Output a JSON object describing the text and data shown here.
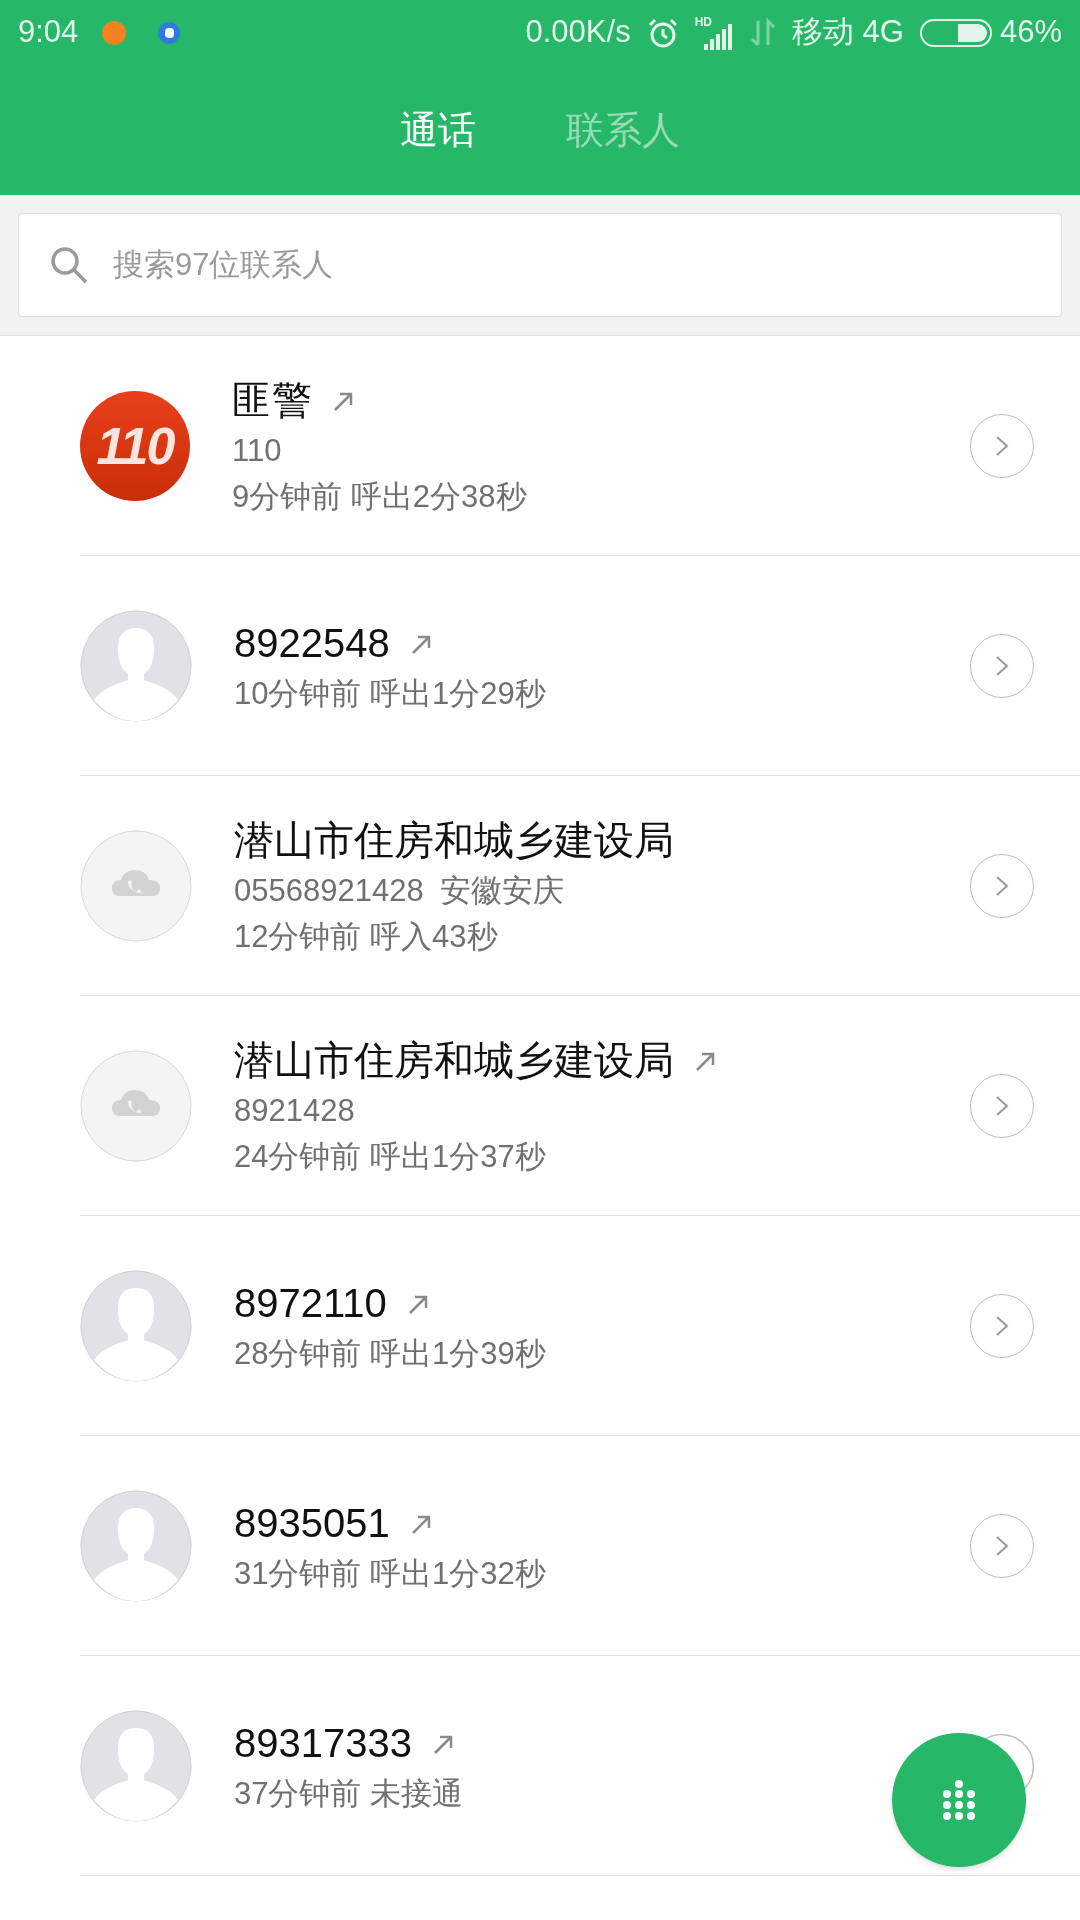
{
  "status_bar": {
    "time": "9:04",
    "speed": "0.00K/s",
    "hd": "HD",
    "carrier": "移动 4G",
    "battery": "46%"
  },
  "tabs": [
    {
      "label": "通话",
      "selected": true
    },
    {
      "label": "联系人",
      "selected": false
    }
  ],
  "search": {
    "placeholder": "搜索97位联系人"
  },
  "calls": [
    {
      "kind": "emergency",
      "avatar_text": "110",
      "name": "匪警",
      "outgoing": true,
      "number": "110",
      "time": "9分钟前 呼出2分38秒"
    },
    {
      "kind": "person",
      "name": "8922548",
      "outgoing": true,
      "time": "10分钟前 呼出1分29秒"
    },
    {
      "kind": "cloud",
      "name": "潜山市住房和城乡建设局",
      "outgoing": false,
      "number": "05568921428",
      "location": "安徽安庆",
      "time": "12分钟前 呼入43秒"
    },
    {
      "kind": "cloud",
      "name": "潜山市住房和城乡建设局",
      "outgoing": true,
      "number": "8921428",
      "time": "24分钟前 呼出1分37秒"
    },
    {
      "kind": "person",
      "name": "8972110",
      "outgoing": true,
      "time": "28分钟前 呼出1分39秒"
    },
    {
      "kind": "person",
      "name": "8935051",
      "outgoing": true,
      "time": "31分钟前 呼出1分32秒"
    },
    {
      "kind": "person",
      "name": "89317333",
      "outgoing": true,
      "time": "37分钟前 未接通"
    }
  ]
}
